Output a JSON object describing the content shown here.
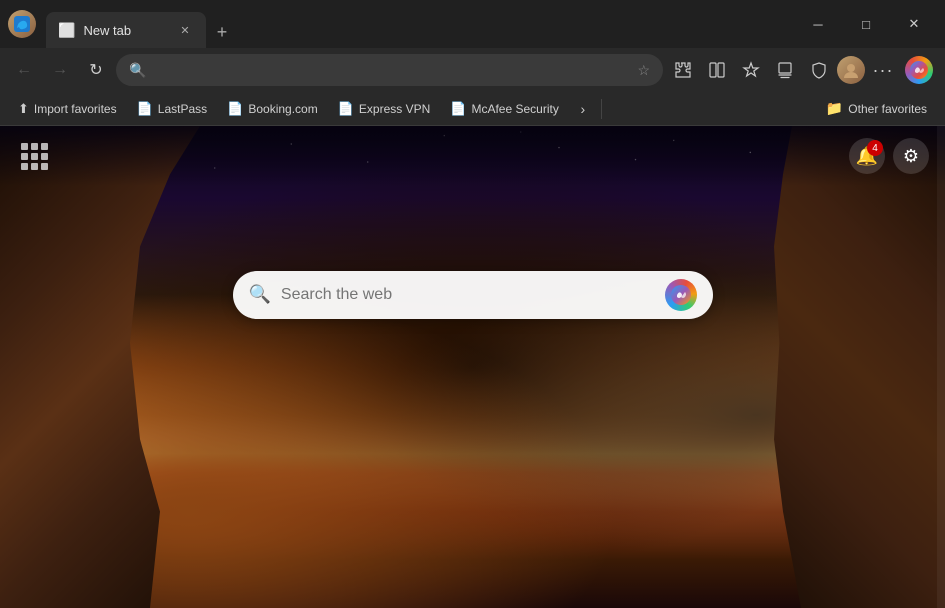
{
  "titleBar": {
    "tabTitle": "New tab",
    "tabIcon": "🌐",
    "newTabTooltip": "New tab",
    "closeLabel": "✕",
    "minimizeLabel": "─",
    "maximizeLabel": "□",
    "windowCloseLabel": "✕"
  },
  "navBar": {
    "backTooltip": "Back",
    "forwardTooltip": "Forward",
    "refreshTooltip": "Refresh",
    "addressPlaceholder": "",
    "addressValue": "",
    "favoriteTooltip": "Add to favorites",
    "extensionsTooltip": "Extensions",
    "splitScreenTooltip": "Split screen",
    "favoritesBarTooltip": "Favorites",
    "collectionsTooltip": "Collections",
    "shieldTooltip": "No tracking",
    "moreTooltip": "More",
    "copilotTooltip": "Copilot",
    "profileTooltip": "Profile"
  },
  "favoritesBar": {
    "items": [
      {
        "label": "Import favorites",
        "icon": "⬆"
      },
      {
        "label": "LastPass",
        "icon": "🔑"
      },
      {
        "label": "Booking.com",
        "icon": "📄"
      },
      {
        "label": "Express VPN",
        "icon": "📄"
      },
      {
        "label": "McAfee Security",
        "icon": "📄"
      }
    ],
    "otherFavoritesLabel": "Other favorites",
    "moreLabel": "›"
  },
  "mainPage": {
    "searchPlaceholder": "Search the web",
    "notificationCount": "4",
    "gridTooltip": "Apps"
  }
}
